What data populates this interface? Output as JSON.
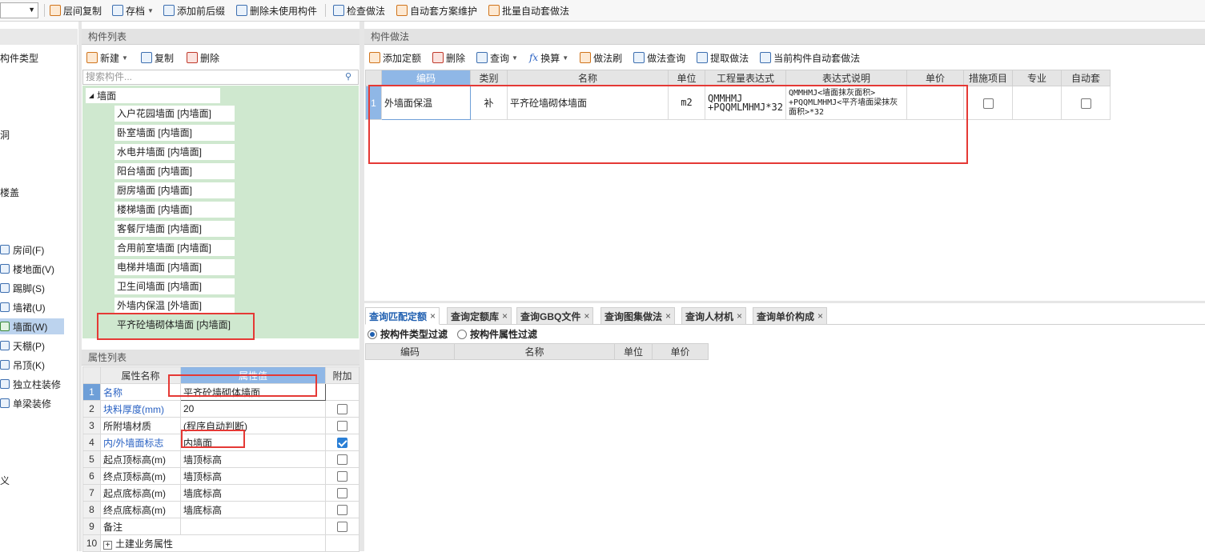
{
  "toolbar": {
    "items": [
      {
        "label": "层间复制",
        "icon": "copy-floor-icon"
      },
      {
        "label": "存档",
        "icon": "archive-icon"
      },
      {
        "label": "添加前后缀",
        "icon": "add-prefix-icon"
      },
      {
        "label": "删除未使用构件",
        "icon": "delete-unused-icon"
      },
      {
        "label": "检查做法",
        "icon": "check-method-icon"
      },
      {
        "label": "自动套方案维护",
        "icon": "auto-scheme-icon"
      },
      {
        "label": "批量自动套做法",
        "icon": "batch-auto-icon"
      }
    ]
  },
  "left_nav": {
    "partial_labels": [
      "构件类型",
      "洞",
      "楼盖",
      "义"
    ],
    "items": [
      {
        "label": "房间(F)",
        "icon": "room-icon"
      },
      {
        "label": "楼地面(V)",
        "icon": "floor-icon"
      },
      {
        "label": "踢脚(S)",
        "icon": "skirting-icon"
      },
      {
        "label": "墙裙(U)",
        "icon": "dado-icon"
      },
      {
        "label": "墙面(W)",
        "icon": "wall-surface-icon",
        "selected": true
      },
      {
        "label": "天棚(P)",
        "icon": "ceiling-icon"
      },
      {
        "label": "吊顶(K)",
        "icon": "suspended-ceiling-icon"
      },
      {
        "label": "独立柱装修",
        "icon": "column-finish-icon"
      },
      {
        "label": "单梁装修",
        "icon": "beam-finish-icon"
      }
    ]
  },
  "component_list": {
    "title": "构件列表",
    "toolbar": {
      "new": "新建",
      "copy": "复制",
      "delete": "删除"
    },
    "search_placeholder": "搜索构件...",
    "root": "墙面",
    "items": [
      "入户花园墙面 [内墙面]",
      "卧室墙面 [内墙面]",
      "水电井墙面 [内墙面]",
      "阳台墙面 [内墙面]",
      "厨房墙面 [内墙面]",
      "楼梯墙面 [内墙面]",
      "客餐厅墙面 [内墙面]",
      "合用前室墙面 [内墙面]",
      "电梯井墙面 [内墙面]",
      "卫生间墙面 [内墙面]",
      "外墙内保温 [外墙面]",
      "平齐砼墙砌体墙面 [内墙面]"
    ]
  },
  "property_list": {
    "title": "属性列表",
    "headers": {
      "name": "属性名称",
      "value": "属性值",
      "extra": "附加"
    },
    "rows": [
      {
        "num": "1",
        "name": "名称",
        "value": "平齐砼墙砌体墙面",
        "check": null,
        "blue": true
      },
      {
        "num": "2",
        "name": "块料厚度(mm)",
        "value": "20",
        "check": false,
        "blue": true
      },
      {
        "num": "3",
        "name": "所附墙材质",
        "value": "(程序自动判断)",
        "check": false,
        "blue": false
      },
      {
        "num": "4",
        "name": "内/外墙面标志",
        "value": "内墙面",
        "check": true,
        "blue": true
      },
      {
        "num": "5",
        "name": "起点顶标高(m)",
        "value": "墙顶标高",
        "check": false,
        "blue": false
      },
      {
        "num": "6",
        "name": "终点顶标高(m)",
        "value": "墙顶标高",
        "check": false,
        "blue": false
      },
      {
        "num": "7",
        "name": "起点底标高(m)",
        "value": "墙底标高",
        "check": false,
        "blue": false
      },
      {
        "num": "8",
        "name": "终点底标高(m)",
        "value": "墙底标高",
        "check": false,
        "blue": false
      },
      {
        "num": "9",
        "name": "备注",
        "value": "",
        "check": false,
        "blue": false
      },
      {
        "num": "10",
        "name": "土建业务属性",
        "value": "",
        "check": null,
        "blue": false,
        "expand": "+"
      }
    ]
  },
  "method_panel": {
    "title": "构件做法",
    "toolbar": [
      "添加定额",
      "删除",
      "查询",
      "换算",
      "做法刷",
      "做法查询",
      "提取做法",
      "当前构件自动套做法"
    ],
    "headers": [
      "编码",
      "类别",
      "名称",
      "单位",
      "工程量表达式",
      "表达式说明",
      "单价",
      "措施项目",
      "专业",
      "自动套"
    ],
    "rows": [
      {
        "num": "1",
        "code": "外墙面保温",
        "category": "补",
        "name": "平齐砼墙砌体墙面",
        "unit": "m2",
        "expr": "QMMHMJ +PQQMLMHMJ*32",
        "expr_desc": "QMMHMJ<墙面抹灰面积> +PQQMLMHMJ<平齐墙面梁抹灰面积>*32",
        "price": "",
        "measure": false,
        "specialty": "",
        "auto": false
      }
    ]
  },
  "bottom_panel": {
    "tabs": [
      "查询匹配定额",
      "查询定额库",
      "查询GBQ文件",
      "查询图集做法",
      "查询人材机",
      "查询单价构成"
    ],
    "close_glyph": "×",
    "filters": [
      "按构件类型过滤",
      "按构件属性过滤"
    ],
    "headers": [
      "编码",
      "名称",
      "单位",
      "单价"
    ]
  }
}
